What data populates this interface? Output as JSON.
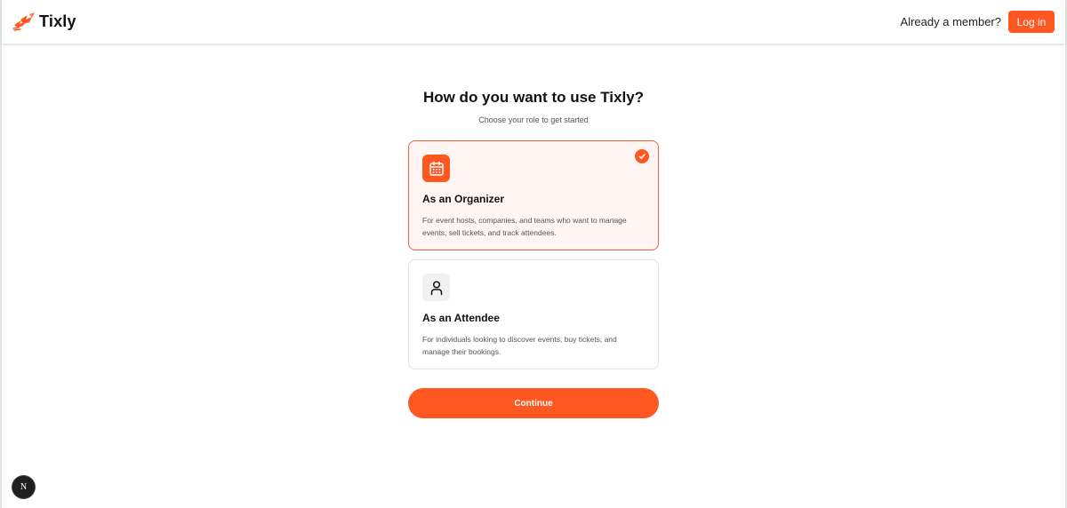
{
  "header": {
    "brand_name": "Tixly",
    "member_text": "Already a member?",
    "login_label": "Log in"
  },
  "main": {
    "title": "How do you want to use Tixly?",
    "subtitle": "Choose your role to get started",
    "roles": [
      {
        "title": "As an Organizer",
        "description": "For event hosts, companies, and teams who want to manage events, sell tickets, and track attendees.",
        "icon": "calendar-icon",
        "selected": true
      },
      {
        "title": "As an Attendee",
        "description": "For individuals looking to discover events, buy tickets, and manage their bookings.",
        "icon": "user-icon",
        "selected": false
      }
    ],
    "continue_label": "Continue"
  },
  "badge": {
    "letter": "N"
  },
  "colors": {
    "accent": "#ff5722",
    "selected_border": "#f0623a",
    "selected_bg": "#fff5f2"
  }
}
